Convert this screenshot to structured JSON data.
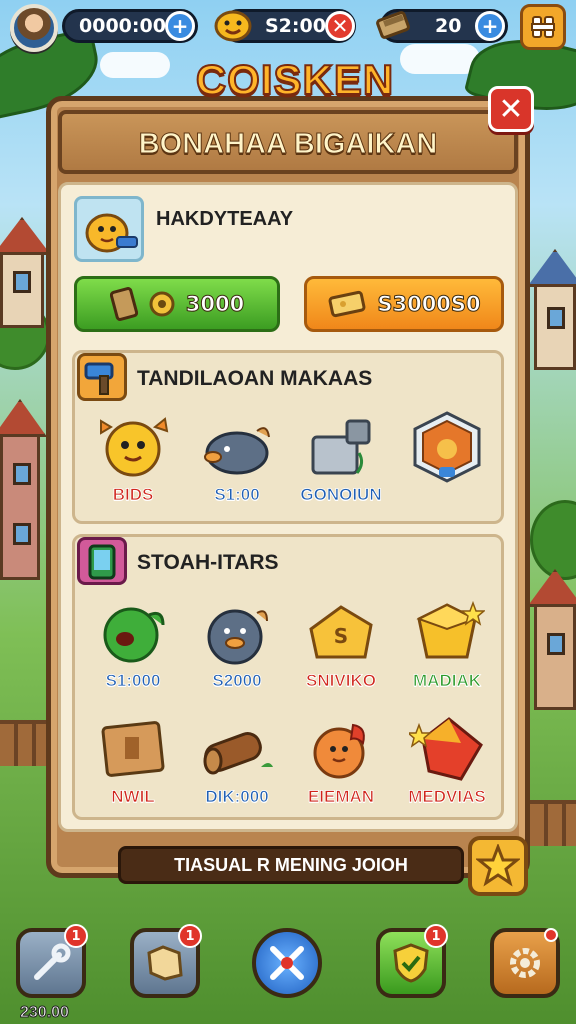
{
  "hud": {
    "coins_value": "0000:00",
    "gold_value": "S2:00",
    "tickets_value": "20",
    "avatar_icon": "player-avatar",
    "menu_icon": "grid-menu-icon"
  },
  "panel": {
    "title": "COISKEN",
    "banner": "BONAHAA BIGAIKAN",
    "hero_name": "HAKDYTEAAY",
    "buy_green_label": "3000",
    "buy_orange_label": "S3000S0",
    "close_icon": "close-icon"
  },
  "sections": {
    "first": {
      "title": "TANDILAOAN MAKAAS",
      "items": [
        {
          "label": "BIDS",
          "icon": "yellow-bird-icon"
        },
        {
          "label": "S1:00",
          "icon": "grey-seal-icon"
        },
        {
          "label": "GONOIUN",
          "icon": "robot-machine-icon"
        },
        {
          "label": "",
          "icon": "orange-badge-icon"
        }
      ]
    },
    "second": {
      "title": "STOAH-ITARS",
      "row1": [
        {
          "label": "S1:000",
          "icon": "green-monster-icon"
        },
        {
          "label": "S2000",
          "icon": "blue-seal-icon"
        },
        {
          "label": "SNIVIKO",
          "icon": "cheese-coin-icon"
        },
        {
          "label": "MADIAK",
          "icon": "gold-cube-icon"
        }
      ],
      "row2": [
        {
          "label": "NWIL",
          "icon": "wooden-crate-icon"
        },
        {
          "label": "DIK:000",
          "icon": "log-cannon-icon"
        },
        {
          "label": "EIEMAN",
          "icon": "fire-chick-icon"
        },
        {
          "label": "MEDVIAS",
          "icon": "red-gem-star-icon"
        }
      ]
    }
  },
  "footer": {
    "bar_text": "TIASUAL R MENING JOIOH"
  },
  "bottom_nav": {
    "value": "230.00",
    "badges": [
      "1",
      "1",
      "1"
    ]
  },
  "colors": {
    "wood": "#b9844f",
    "paper": "#f6edd6",
    "accent_orange": "#ffb52a",
    "button_green": "#3c9d22",
    "button_orange": "#f0871a"
  }
}
